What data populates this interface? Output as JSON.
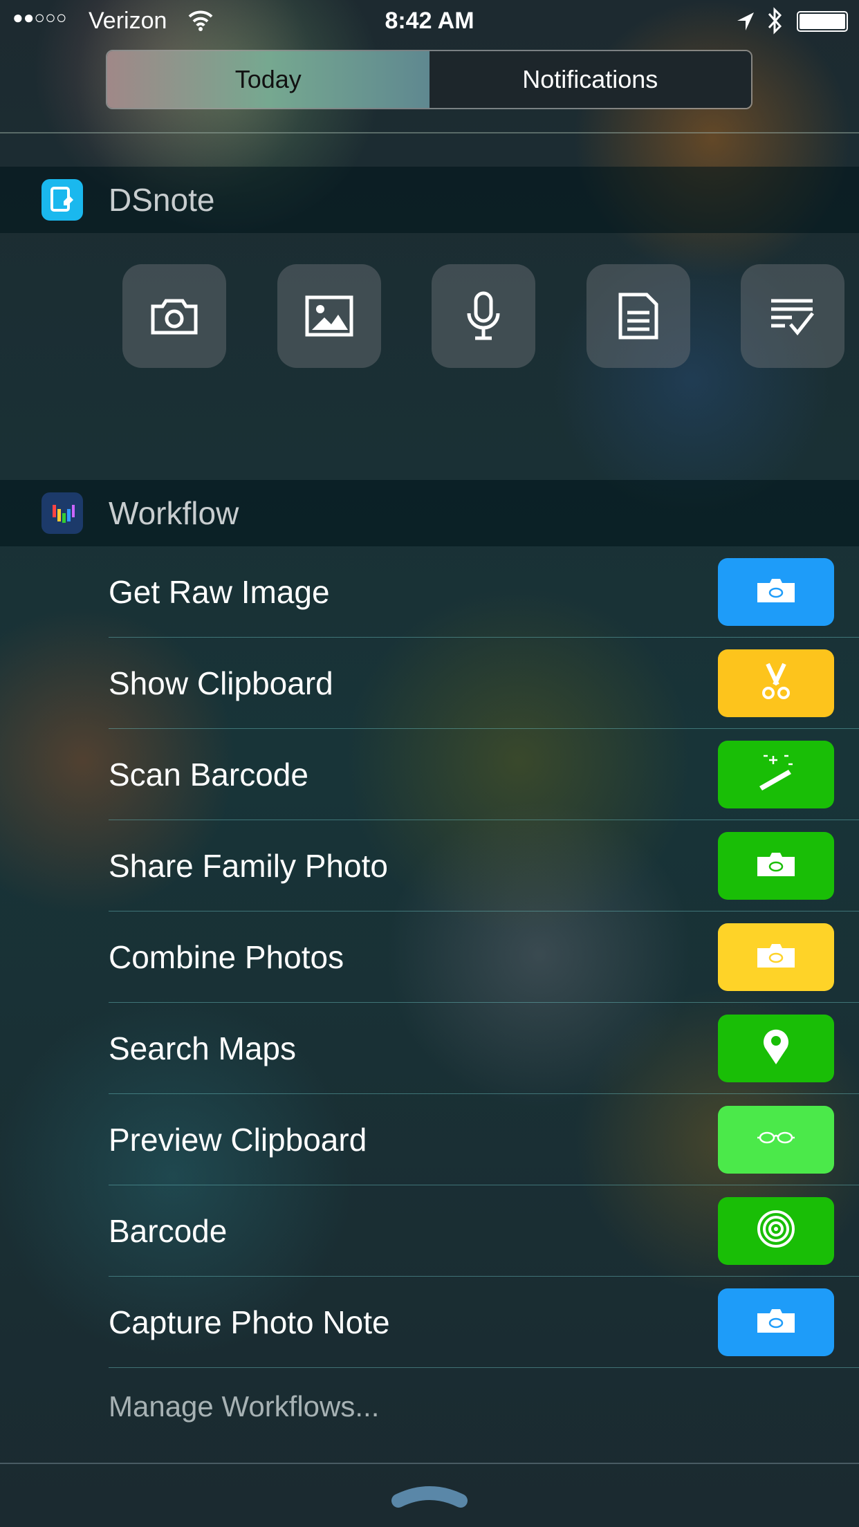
{
  "status_bar": {
    "signal": "●●○○○",
    "carrier": "Verizon",
    "time": "8:42 AM"
  },
  "segments": {
    "today": "Today",
    "notifications": "Notifications"
  },
  "dsnote": {
    "title": "DSnote",
    "actions": [
      "camera-icon",
      "image-icon",
      "microphone-icon",
      "note-icon",
      "checklist-icon"
    ]
  },
  "workflow": {
    "title": "Workflow",
    "items": [
      {
        "label": "Get Raw Image",
        "color": "#1e9cf9",
        "icon": "camera-icon"
      },
      {
        "label": "Show Clipboard",
        "color": "#fdc41c",
        "icon": "scissors-icon"
      },
      {
        "label": "Scan Barcode",
        "color": "#19be06",
        "icon": "magic-wand-icon"
      },
      {
        "label": "Share Family Photo",
        "color": "#19be06",
        "icon": "camera-icon"
      },
      {
        "label": "Combine Photos",
        "color": "#fed328",
        "icon": "camera-icon"
      },
      {
        "label": "Search Maps",
        "color": "#19be06",
        "icon": "map-pin-icon"
      },
      {
        "label": "Preview Clipboard",
        "color": "#4be94a",
        "icon": "glasses-icon"
      },
      {
        "label": "Barcode",
        "color": "#19be06",
        "icon": "target-icon"
      },
      {
        "label": "Capture Photo Note",
        "color": "#1e9cf9",
        "icon": "camera-icon"
      }
    ],
    "manage": "Manage Workflows..."
  }
}
